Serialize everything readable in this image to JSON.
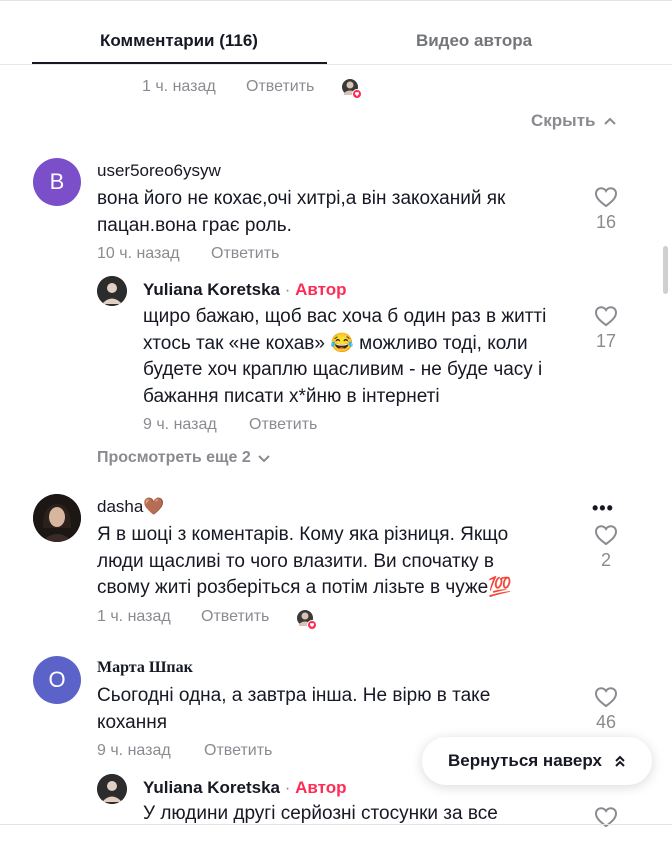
{
  "tabs": {
    "comments_label": "Комментарии (116)",
    "author_videos_label": "Видео автора"
  },
  "top_reply": {
    "time": "1 ч. назад",
    "reply_label": "Ответить"
  },
  "hide_label": "Скрыть",
  "comments": [
    {
      "avatar_letter": "B",
      "avatar_color": "#7b4fc9",
      "username": "user5oreo6ysyw",
      "lines": [
        "вона його не кохає,очі хитрі,а він закоханий як",
        "пацан.вона грає роль."
      ],
      "time": "10 ч. назад",
      "reply_label": "Ответить",
      "likes": "16"
    },
    {
      "username": "Yuliana Koretska",
      "author_tag": "Автор",
      "separator": "·",
      "lines": [
        "щиро бажаю, щоб вас хоча б один раз в житті",
        "хтось так «не кохав» 😂 можливо тоді, коли",
        "будете хоч краплю щасливим - не буде часу і",
        "бажання писати х*йню в інтернеті"
      ],
      "time": "9 ч. назад",
      "reply_label": "Ответить",
      "likes": "17"
    },
    {
      "more_label": "Просмотреть еще 2"
    },
    {
      "username": "dasha🤎",
      "lines": [
        "Я в шоці з коментарів. Кому яка різниця. Якщо",
        "люди щасливі то чого влазити. Ви спочатку в",
        "свому житі розберіться а потім лізьте в чуже💯"
      ],
      "time": "1 ч. назад",
      "reply_label": "Ответить",
      "likes": "2",
      "more_icon": "•••"
    },
    {
      "avatar_letter": "O",
      "avatar_color": "#5b63c9",
      "username": "Марта Шпак",
      "lines": [
        "Сьогодні одна, а завтра інша. Не вірю в таке",
        "кохання"
      ],
      "time": "9 ч. назад",
      "reply_label": "Ответить",
      "likes": "46"
    },
    {
      "username": "Yuliana Koretska",
      "author_tag": "Автор",
      "separator": "·",
      "lines": [
        "У людини другі серйозні стосунки за все"
      ]
    }
  ],
  "back_to_top_label": "Вернуться наверх",
  "colors": {
    "author_red": "#fe2c55",
    "text": "#161823",
    "muted": "#8a8b91"
  }
}
